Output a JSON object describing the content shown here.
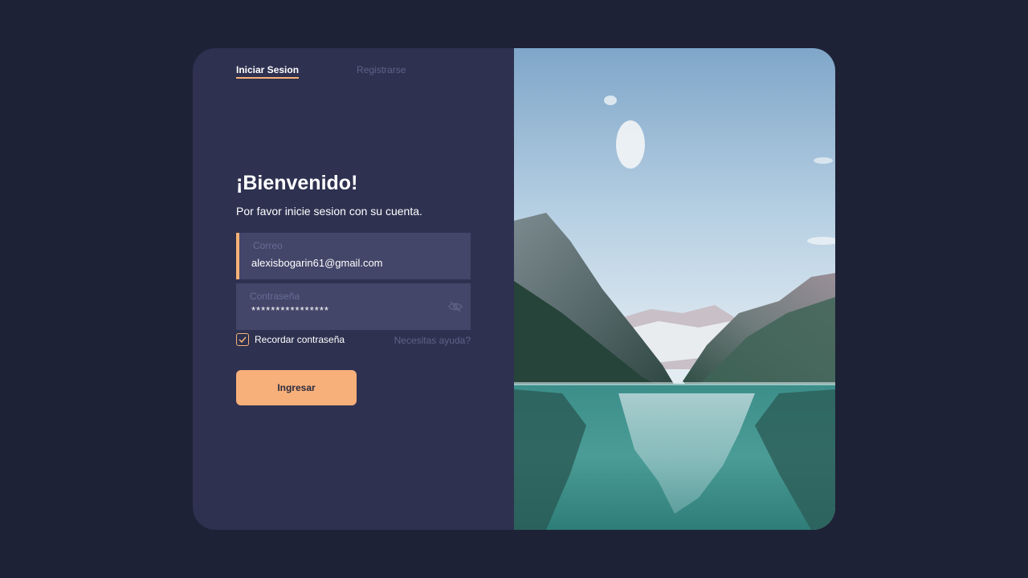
{
  "tabs": {
    "login": "Iniciar Sesion",
    "register": "Registrarse"
  },
  "welcome": {
    "title": "¡Bienvenido!",
    "subtitle": "Por favor inicie sesion con su cuenta."
  },
  "form": {
    "email_label": "Correo",
    "email_value": "alexisbogarin61@gmail.com",
    "password_label": "Contraseña",
    "password_value": "****************",
    "remember_label": "Recordar contraseña",
    "remember_checked": true,
    "help_link": "Necesitas ayuda?",
    "submit_label": "Ingresar"
  },
  "icons": {
    "password_toggle": "eye-off-icon",
    "checkbox": "check-icon"
  },
  "image": {
    "subject": "mountain-lake-photo"
  },
  "colors": {
    "background": "#1e2236",
    "panel": "#2e3150",
    "field": "#434669",
    "accent": "#f6b176",
    "text": "#ffffff",
    "muted": "#5d6287"
  }
}
